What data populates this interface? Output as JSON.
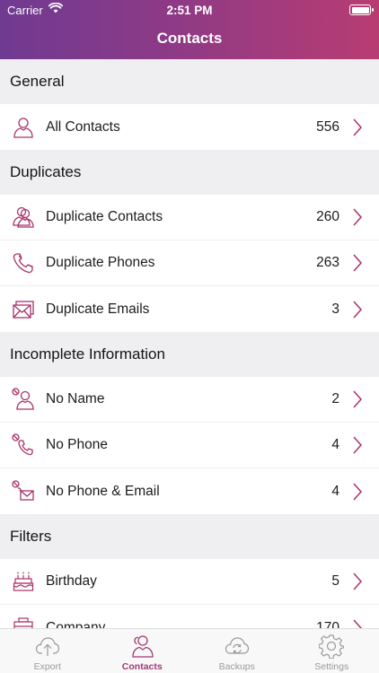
{
  "status_bar": {
    "carrier": "Carrier",
    "time": "2:51 PM"
  },
  "nav": {
    "title": "Contacts"
  },
  "accent_color": "#a8336b",
  "sections": [
    {
      "title": "General",
      "rows": [
        {
          "label": "All Contacts",
          "count": "556",
          "icon": "person-icon"
        }
      ]
    },
    {
      "title": "Duplicates",
      "rows": [
        {
          "label": "Duplicate Contacts",
          "count": "260",
          "icon": "two-persons-icon"
        },
        {
          "label": "Duplicate Phones",
          "count": "263",
          "icon": "phone-icon"
        },
        {
          "label": "Duplicate Emails",
          "count": "3",
          "icon": "envelopes-icon"
        }
      ]
    },
    {
      "title": "Incomplete Information",
      "rows": [
        {
          "label": "No Name",
          "count": "2",
          "icon": "no-name-icon"
        },
        {
          "label": "No Phone",
          "count": "4",
          "icon": "no-phone-icon"
        },
        {
          "label": "No Phone & Email",
          "count": "4",
          "icon": "no-phone-email-icon"
        }
      ]
    },
    {
      "title": "Filters",
      "rows": [
        {
          "label": "Birthday",
          "count": "5",
          "icon": "birthday-cake-icon"
        },
        {
          "label": "Company",
          "count": "170",
          "icon": "company-icon"
        }
      ]
    }
  ],
  "tabs": [
    {
      "label": "Export",
      "icon": "cloud-upload-icon",
      "active": false
    },
    {
      "label": "Contacts",
      "icon": "contacts-icon",
      "active": true
    },
    {
      "label": "Backups",
      "icon": "cloud-sync-icon",
      "active": false
    },
    {
      "label": "Settings",
      "icon": "gear-icon",
      "active": false
    }
  ]
}
